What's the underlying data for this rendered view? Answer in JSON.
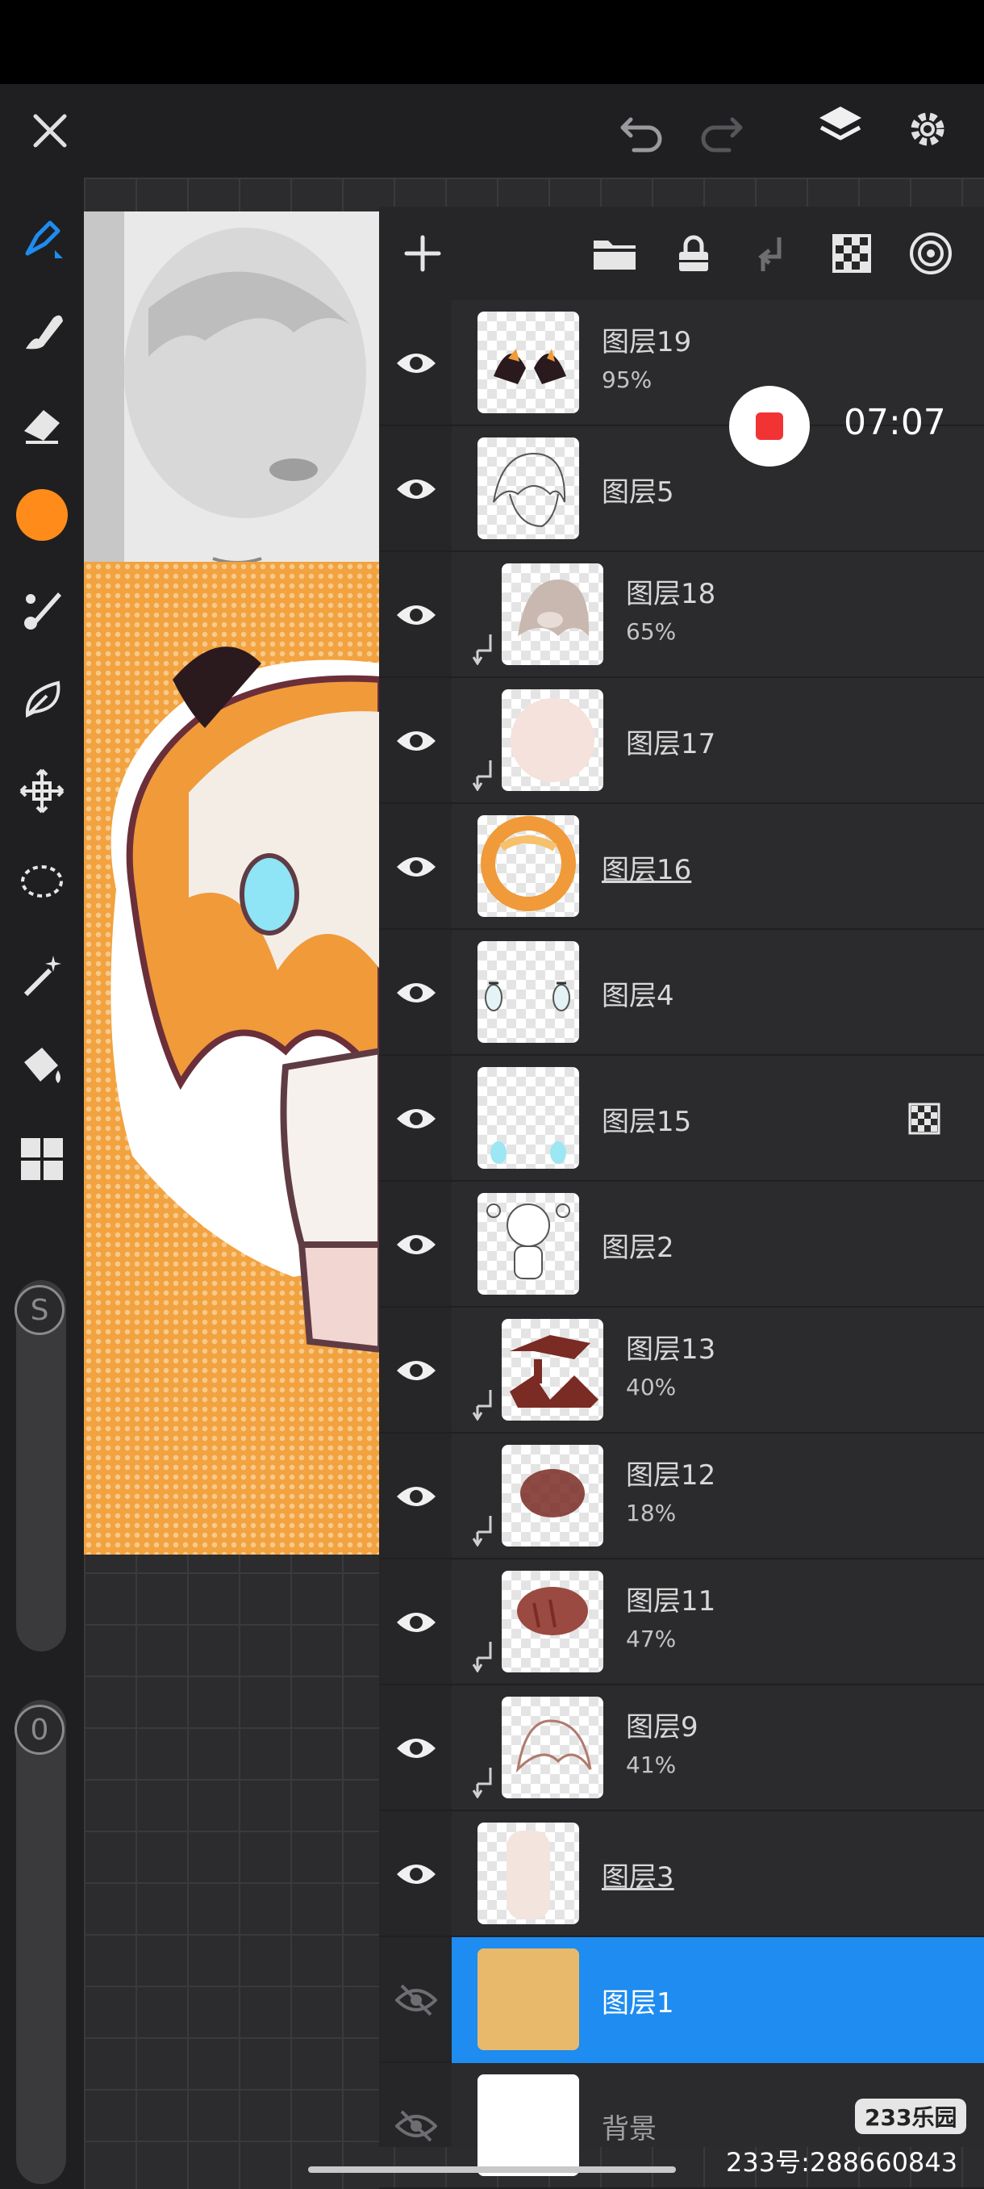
{
  "top_toolbar": {
    "close_icon": "close-icon",
    "undo_icon": "undo-icon",
    "redo_icon": "redo-icon",
    "layers_icon": "layers-icon",
    "settings_icon": "gear-icon"
  },
  "left_tools": [
    "brush-icon",
    "smudge-icon",
    "eraser-icon",
    "color-swatch",
    "brush-alt-icon",
    "liquify-icon",
    "transform-icon",
    "lasso-icon",
    "magic-wand-icon",
    "fill-bucket-icon",
    "grid-icon"
  ],
  "color_swatch": "#ff8c1a",
  "sliders": {
    "size_label": "S",
    "opacity_label": "0"
  },
  "layers_panel": {
    "header_icons": [
      "add-layer-icon",
      "folder-icon",
      "lock-icon",
      "merge-down-icon",
      "alpha-lock-icon",
      "reference-icon"
    ],
    "layers": [
      {
        "name": "图层19",
        "opacity": "95%",
        "visible": true,
        "clipped": false,
        "underline": false
      },
      {
        "name": "图层5",
        "opacity": "",
        "visible": true,
        "clipped": false,
        "underline": false
      },
      {
        "name": "图层18",
        "opacity": "65%",
        "visible": true,
        "clipped": true,
        "underline": false
      },
      {
        "name": "图层17",
        "opacity": "",
        "visible": true,
        "clipped": true,
        "underline": false
      },
      {
        "name": "图层16",
        "opacity": "",
        "visible": true,
        "clipped": false,
        "underline": true
      },
      {
        "name": "图层4",
        "opacity": "",
        "visible": true,
        "clipped": false,
        "underline": false
      },
      {
        "name": "图层15",
        "opacity": "",
        "visible": true,
        "clipped": false,
        "underline": false,
        "alpha_lock": true
      },
      {
        "name": "图层2",
        "opacity": "",
        "visible": true,
        "clipped": false,
        "underline": false
      },
      {
        "name": "图层13",
        "opacity": "40%",
        "visible": true,
        "clipped": true,
        "underline": false
      },
      {
        "name": "图层12",
        "opacity": "18%",
        "visible": true,
        "clipped": true,
        "underline": false
      },
      {
        "name": "图层11",
        "opacity": "47%",
        "visible": true,
        "clipped": true,
        "underline": false
      },
      {
        "name": "图层9",
        "opacity": "41%",
        "visible": true,
        "clipped": true,
        "underline": false
      },
      {
        "name": "图层3",
        "opacity": "",
        "visible": true,
        "clipped": false,
        "underline": true
      },
      {
        "name": "图层1",
        "opacity": "",
        "visible": false,
        "clipped": false,
        "underline": false,
        "selected": true
      },
      {
        "name": "背景",
        "opacity": "",
        "visible": false,
        "clipped": false,
        "underline": false
      }
    ]
  },
  "recording": {
    "time": "07:07"
  },
  "watermark": {
    "logo": "233乐园",
    "text": "233号:288660843"
  },
  "accent_color": "#1e8cf0"
}
